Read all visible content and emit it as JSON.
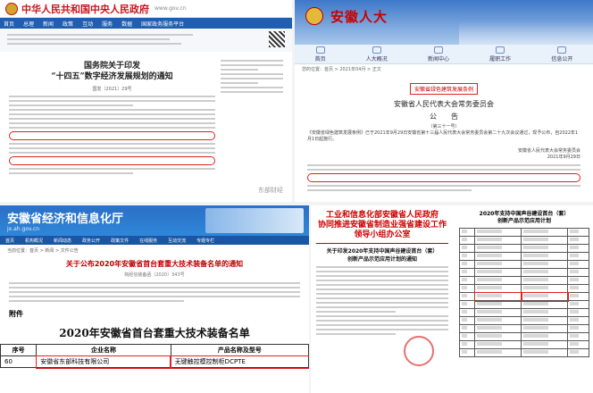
{
  "top_left": {
    "site_title": "中华人民共和国中央人民政府",
    "site_en": "www.gov.cn",
    "nav": [
      "首页",
      "总理",
      "新闻",
      "政策",
      "互动",
      "服务",
      "数据",
      "国家政务服务平台"
    ],
    "doc_title": "国务院关于印发\n“十四五”数字经济发展规划的通知",
    "doc_meta": "国发〔2021〕29号",
    "watermark": "东部财经"
  },
  "top_right": {
    "site_title": "安徽人大",
    "nav": [
      "首页",
      "人大概况",
      "新闻中心",
      "履职工作",
      "信息公开"
    ],
    "crumb": "您的位置：首页 > 2021年04月 > 正文",
    "red_box": "安徽省绿色建筑发展条例",
    "heading": "安徽省人民代表大会常务委员会",
    "subheading": "公　　告",
    "number": "（第三十一号）",
    "body": "《安徽省绿色建筑发展条例》已于2021年9月29日安徽省第十三届人民代表大会常务委员会第二十九次会议通过，现予公布，自2022年1月1日起施行。",
    "sign": "安徽省人民代表大会常务委员会\n2021年9月29日"
  },
  "bottom_left": {
    "site_title": "安徽省经济和信息化厅",
    "site_url": "jx.ah.gov.cn",
    "nav": [
      "首页",
      "机构概况",
      "新闻动态",
      "政务公开",
      "政策文件",
      "在线服务",
      "互动交流",
      "专题专栏"
    ],
    "crumb": "当前位置：首页 > 新闻 > 文件公告",
    "notice_title": "关于公布2020年安徽省首台套重大技术装备名单的通知",
    "notice_meta": "皖经信装备函〔2020〕343号",
    "annex": "附件",
    "table_title": "2020年安徽省首台套重大技术装备名单",
    "table_headers": [
      "序号",
      "企业名称",
      "产品名称及型号"
    ],
    "table_rows": [
      [
        "60",
        "安徽省东部科技有限公司",
        "无键触控模控制柜DCPTE"
      ]
    ]
  },
  "bottom_right": {
    "head": "工业和信息化部安徽省人民政府\n协同推进安徽省制造业强省建设工作领导小组办公室",
    "sub": "关于印发2020年支持中国声谷建设首台（套）\n创新产品示范应用计划的通知",
    "right_title": "2020年支持中国声谷建设首台（套）\n创新产品示范应用计划",
    "row_count": 16
  }
}
